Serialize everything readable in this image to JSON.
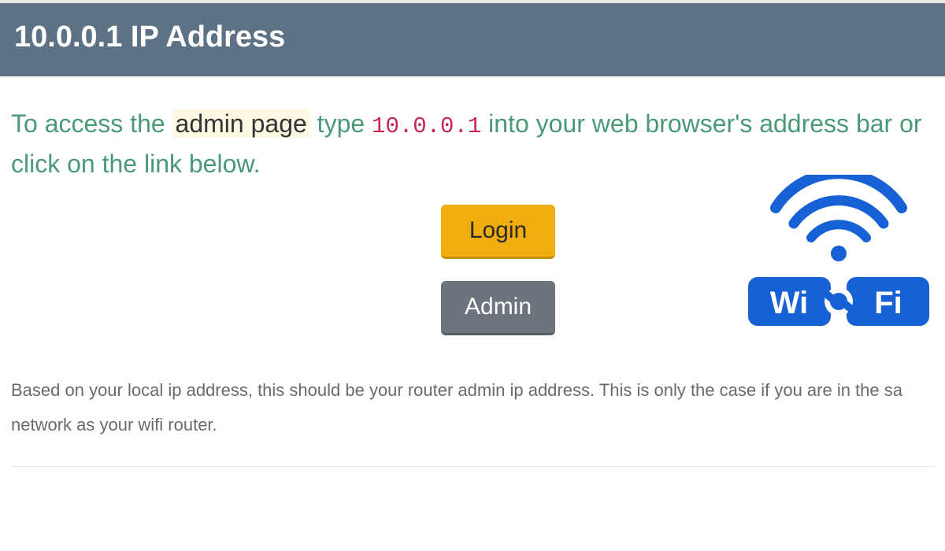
{
  "header": {
    "title": "10.0.0.1 IP Address"
  },
  "intro": {
    "prefix": "To access the ",
    "highlight": "admin page",
    "mid1": " type ",
    "ip": "10.0.0.1",
    "mid2": " into your web browser's address bar or click on the link below."
  },
  "buttons": {
    "login": "Login",
    "admin": "Admin"
  },
  "note": "Based on your local ip address, this should be your router admin ip address. This is only the case if you are in the sa network as your wifi router.",
  "wifi_logo": {
    "text_left": "Wi",
    "text_right": "Fi"
  },
  "colors": {
    "header_bg": "#5e7286",
    "intro_text": "#4a9a7a",
    "highlight_bg": "#fcf8e3",
    "ip_text": "#c7254e",
    "login_bg": "#f0ad0e",
    "admin_bg": "#6c757d",
    "wifi_blue": "#1761d6"
  }
}
